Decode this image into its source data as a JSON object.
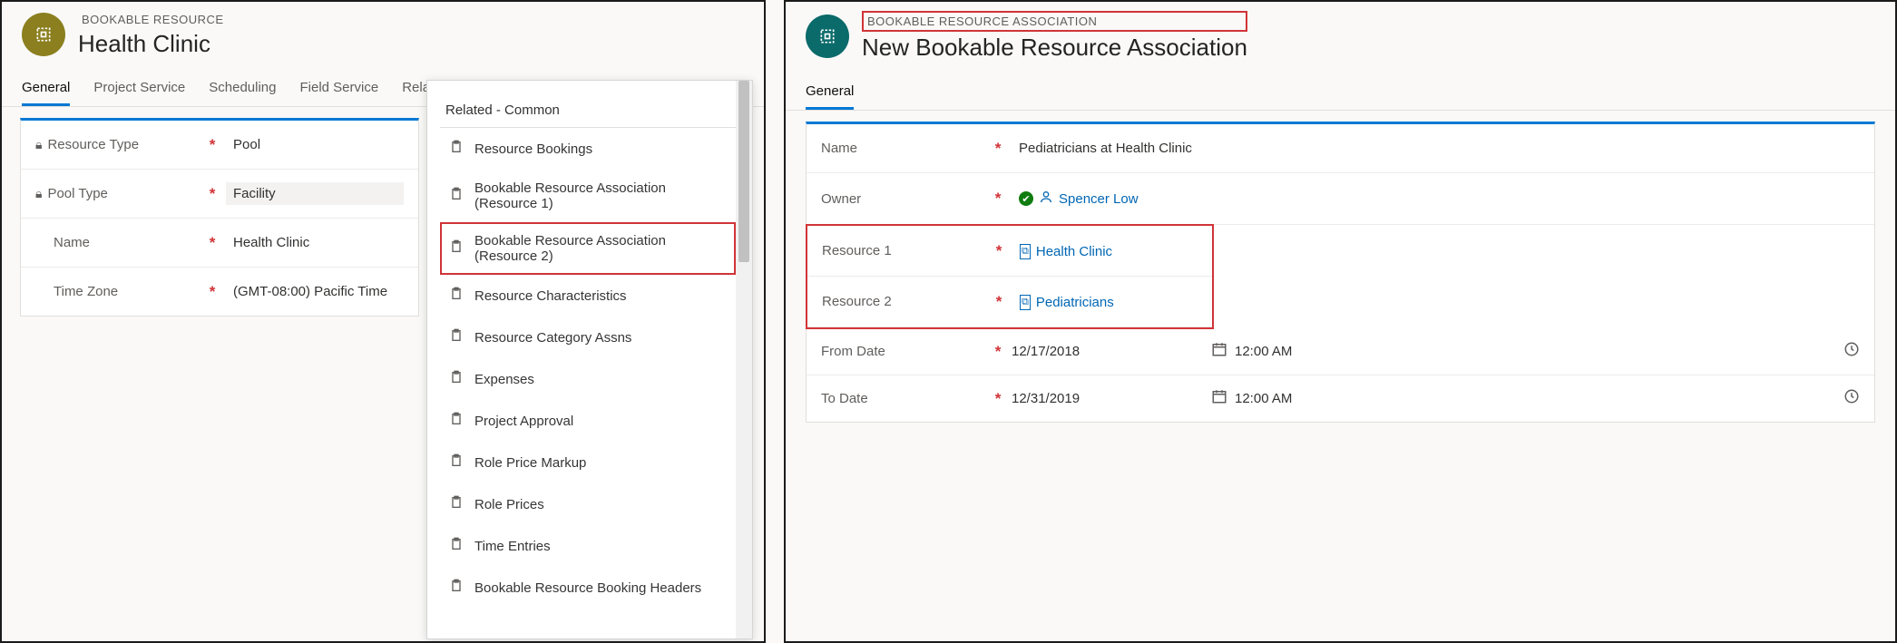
{
  "left": {
    "entityLabel": "BOOKABLE RESOURCE",
    "title": "Health Clinic",
    "tabs": [
      "General",
      "Project Service",
      "Scheduling",
      "Field Service",
      "Related"
    ],
    "fields": {
      "resourceType": {
        "label": "Resource Type",
        "value": "Pool",
        "locked": true
      },
      "poolType": {
        "label": "Pool Type",
        "value": "Facility",
        "locked": true,
        "shaded": true
      },
      "name": {
        "label": "Name",
        "value": "Health Clinic"
      },
      "timeZone": {
        "label": "Time Zone",
        "value": "(GMT-08:00) Pacific Time"
      }
    },
    "related": {
      "heading": "Related - Common",
      "items": [
        "Resource Bookings",
        "Bookable Resource Association (Resource 1)",
        "Bookable Resource Association (Resource 2)",
        "Resource Characteristics",
        "Resource Category Assns",
        "Expenses",
        "Project Approval",
        "Role Price Markup",
        "Role Prices",
        "Time Entries",
        "Bookable Resource Booking Headers"
      ],
      "highlightedIndex": 2
    }
  },
  "right": {
    "entityLabel": "BOOKABLE RESOURCE ASSOCIATION",
    "title": "New Bookable Resource Association",
    "tab": "General",
    "fields": {
      "name": {
        "label": "Name",
        "value": "Pediatricians at Health Clinic"
      },
      "owner": {
        "label": "Owner",
        "value": "Spencer Low"
      },
      "res1": {
        "label": "Resource 1",
        "value": "Health Clinic"
      },
      "res2": {
        "label": "Resource 2",
        "value": "Pediatricians"
      },
      "fromDate": {
        "label": "From Date",
        "date": "12/17/2018",
        "time": "12:00 AM"
      },
      "toDate": {
        "label": "To Date",
        "date": "12/31/2019",
        "time": "12:00 AM"
      }
    }
  }
}
